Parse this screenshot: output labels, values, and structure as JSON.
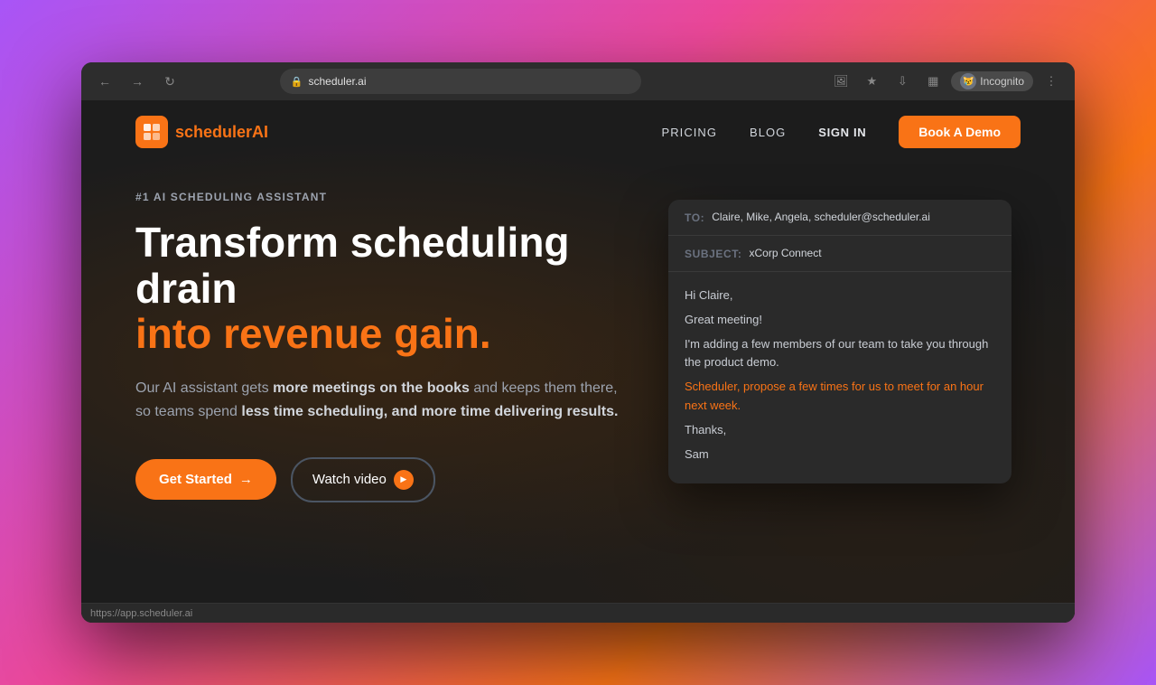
{
  "browser": {
    "url": "scheduler.ai",
    "incognito_label": "Incognito",
    "status_url": "https://app.scheduler.ai"
  },
  "nav": {
    "logo_text_main": "scheduler",
    "logo_text_accent": "AI",
    "pricing_label": "PRICING",
    "blog_label": "BLOG",
    "sign_in_label": "SIGN IN",
    "book_demo_label": "Book A Demo"
  },
  "hero": {
    "badge": "#1 AI SCHEDULING ASSISTANT",
    "title_main": "Transform scheduling drain",
    "title_highlight": "into revenue gain.",
    "description": "Our AI assistant gets more meetings on the books and keeps them there, so teams spend less time scheduling, and more time delivering results.",
    "get_started_label": "Get Started",
    "watch_video_label": "Watch video"
  },
  "email_card": {
    "to_label": "TO:",
    "to_value": "Claire, Mike, Angela, scheduler@scheduler.ai",
    "subject_label": "SUBJECT:",
    "subject_value": "xCorp Connect",
    "body_greeting": "Hi Claire,",
    "body_line1": "Great meeting!",
    "body_line2": "I'm adding a few members of our team to take you through the product demo.",
    "body_highlight": "Scheduler, propose a few times for us to meet for an hour next week.",
    "body_sign_off": "Thanks,",
    "body_signature": "Sam"
  }
}
